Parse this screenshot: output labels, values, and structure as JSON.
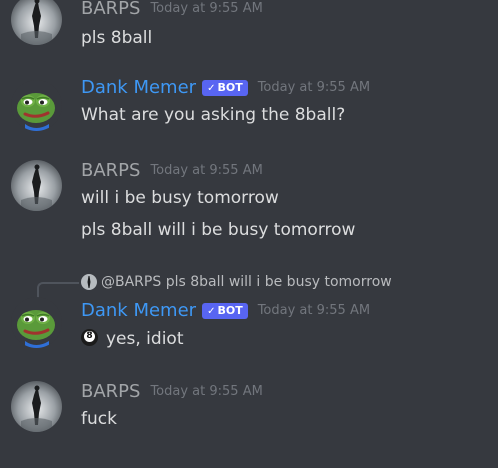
{
  "messages": [
    {
      "author": "BARPS",
      "timestamp": "Today at 9:55 AM",
      "lines": [
        "pls 8ball"
      ]
    },
    {
      "author": "Dank Memer",
      "bot_tag": "BOT",
      "timestamp": "Today at 9:55 AM",
      "lines": [
        "What are you asking the 8ball?"
      ]
    },
    {
      "author": "BARPS",
      "timestamp": "Today at 9:55 AM",
      "lines": [
        "will i be busy tomorrow",
        "pls 8ball will i be busy tomorrow"
      ]
    },
    {
      "reply": {
        "mention": "@BARPS",
        "text": "pls 8ball will i be busy tomorrow"
      },
      "author": "Dank Memer",
      "bot_tag": "BOT",
      "timestamp": "Today at 9:55 AM",
      "lines": [
        "yes, idiot"
      ],
      "emoji": "8-ball-icon",
      "emoji_number": "8"
    },
    {
      "author": "BARPS",
      "timestamp": "Today at 9:55 AM",
      "lines": [
        "fuck"
      ]
    }
  ],
  "colors": {
    "background": "#36393f",
    "bot_name": "#3e98f5",
    "user_name": "#a2a5a8",
    "bot_tag": "#5865f2",
    "timestamp": "#72767d",
    "text": "#dcddde"
  },
  "bot_tag_check": "✓"
}
